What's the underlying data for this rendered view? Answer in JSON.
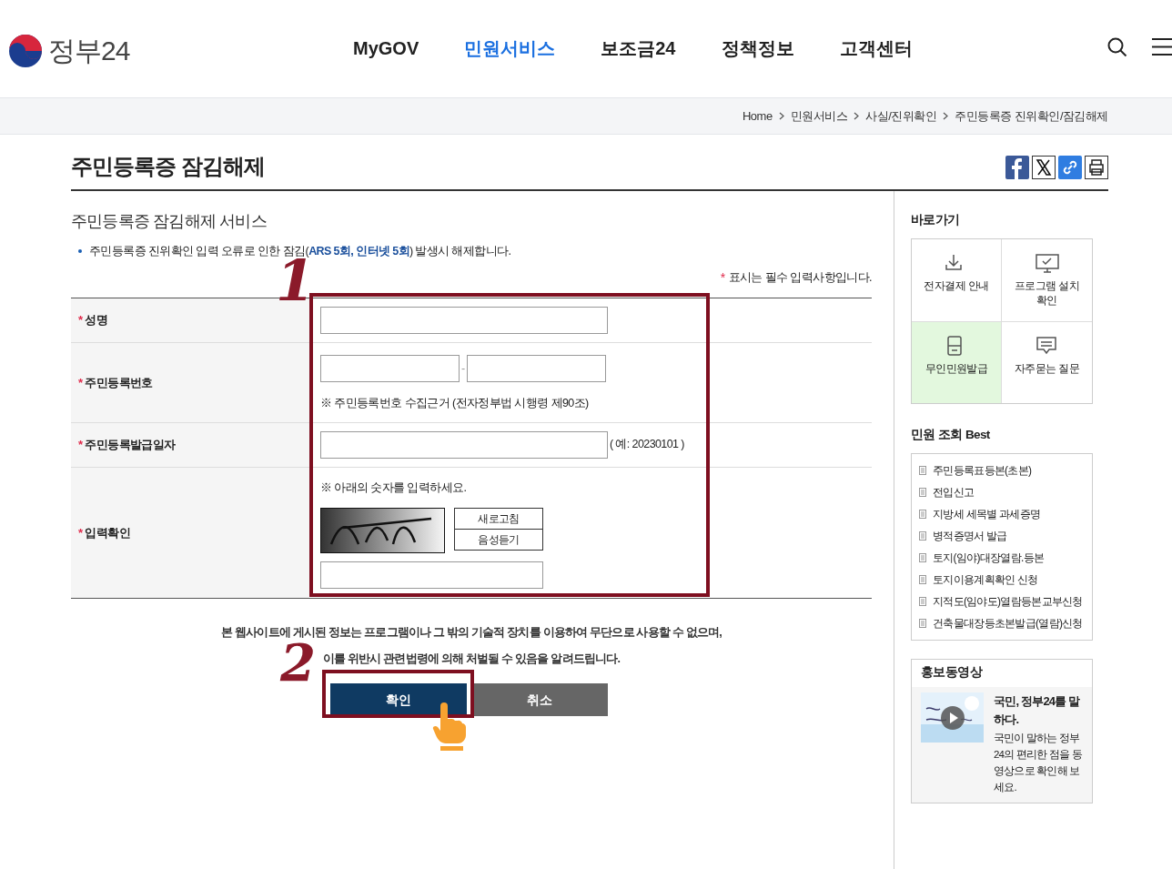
{
  "header": {
    "logo_text": "정부24",
    "nav": [
      {
        "label": "MyGOV",
        "selected": false
      },
      {
        "label": "민원서비스",
        "selected": true
      },
      {
        "label": "보조금24",
        "selected": false
      },
      {
        "label": "정책정보",
        "selected": false
      },
      {
        "label": "고객센터",
        "selected": false
      }
    ]
  },
  "breadcrumb": [
    "Home",
    "민원서비스",
    "사실/진위확인",
    "주민등록증 진위확인/잠김해제"
  ],
  "page_title": "주민등록증 잠김해제",
  "section_title": "주민등록증 잠김해제 서비스",
  "notice": "주민등록증 진위확인 입력 오류로 인한 잠김(**ARS 5회, 인터넷 5회**) 발생시 해제합니다.",
  "required_note": "표시는 필수 입력사항입니다.",
  "required_mark": "*",
  "form": [
    {
      "kind": "name",
      "label": "성명"
    },
    {
      "kind": "rrn",
      "label": "주민등록번호",
      "separator": "-",
      "note": "※ 주민등록번호 수집근거 (전자정부법 시행령 제90조)"
    },
    {
      "kind": "date",
      "label": "주민등록발급일자",
      "hint": "( 예: 20230101 )"
    },
    {
      "kind": "captcha",
      "label": "입력확인",
      "note": "※ 아래의 숫자를 입력하세요.",
      "buttons": [
        "새로고침",
        "음성듣기"
      ]
    }
  ],
  "warning": [
    "본 웹사이트에 게시된 정보는 프로그램이나 그 밖의 기술적 장치를 이용하여 무단으로 사용할 수 없으며,",
    "이를 위반시 관련법령에 의해 처벌될 수 있음을 알려드립니다."
  ],
  "buttons": [
    {
      "label": "확인",
      "kind": "primary"
    },
    {
      "label": "취소",
      "kind": "secondary"
    }
  ],
  "annotations": [
    "1",
    "2"
  ],
  "sidebar": {
    "shortcuts_title": "바로가기",
    "shortcuts": [
      {
        "label": "전자결제 안내",
        "kind": "download",
        "highlighted": false
      },
      {
        "label": "프로그램 설치 확인",
        "kind": "monitor",
        "highlighted": false
      },
      {
        "label": "무인민원발급",
        "kind": "kiosk",
        "highlighted": true
      },
      {
        "label": "자주묻는 질문",
        "kind": "chat",
        "highlighted": false
      }
    ],
    "best_title": "민원 조회 Best",
    "best": [
      "주민등록표등본(초본)",
      "전입신고",
      "지방세 세목별 과세증명",
      "병적증명서 발급",
      "토지(임야)대장열람.등본",
      "토지이용계획확인 신청",
      "지적도(임야도)열람등본교부신청",
      "건축물대장등초본발급(열람)신청"
    ],
    "video_title": "홍보동영상",
    "video_caption": "국민, 정부24를 말하다.",
    "video_desc": "국민이 말하는 정부24의 편리한 점을 동영상으로 확인해 보세요."
  }
}
